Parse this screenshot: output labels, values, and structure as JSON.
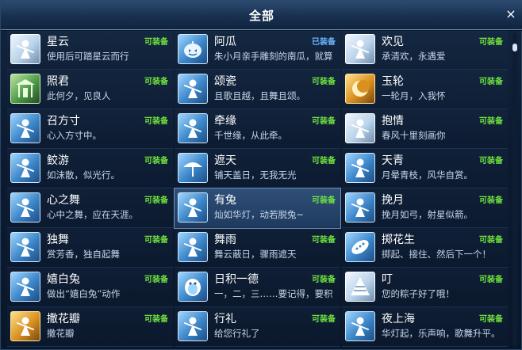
{
  "header": {
    "title": "全部",
    "close_icon": "×"
  },
  "items": [
    {
      "name": "星云",
      "desc": "使用后可踏星云而行",
      "status": "可装备",
      "icon": "figure-icon",
      "state": "available"
    },
    {
      "name": "阿瓜",
      "desc": "朱小月亲手雕刻的南瓜，就算",
      "status": "已装备",
      "icon": "pumpkin-icon",
      "state": "equipped"
    },
    {
      "name": "欢见",
      "desc": "承清欢，永遇爱",
      "status": "可装备",
      "icon": "couple-icon",
      "state": "available"
    },
    {
      "name": "照君",
      "desc": "此何夕，见良人",
      "status": "可装备",
      "icon": "pavilion-icon",
      "state": "available"
    },
    {
      "name": "颂瓷",
      "desc": "且歌且越，且舞且颂。",
      "status": "可装备",
      "icon": "dancer-icon",
      "state": "available"
    },
    {
      "name": "玉轮",
      "desc": "一轮月，入我怀",
      "status": "可装备",
      "icon": "moon-icon",
      "state": "available"
    },
    {
      "name": "召方寸",
      "desc": "心入方寸中。",
      "status": "可装备",
      "icon": "box-icon",
      "state": "available"
    },
    {
      "name": "牵缘",
      "desc": "千世缘，从此牵。",
      "status": "可装备",
      "icon": "wave-icon",
      "state": "available"
    },
    {
      "name": "抱情",
      "desc": "春风十里刻画你",
      "status": "可装备",
      "icon": "hug-icon",
      "state": "available"
    },
    {
      "name": "鲛游",
      "desc": "如沫散，似光行。",
      "status": "可装备",
      "icon": "fish-icon",
      "state": "available"
    },
    {
      "name": "遮天",
      "desc": "铺天盖日，无我无光",
      "status": "可装备",
      "icon": "umbrella-icon",
      "state": "available"
    },
    {
      "name": "天青",
      "desc": "月晕青枝，风华自赏。",
      "status": "可装备",
      "icon": "branch-icon",
      "state": "available"
    },
    {
      "name": "心之舞",
      "desc": "心中之舞，应在天涯。",
      "status": "可装备",
      "icon": "dance-icon",
      "state": "available"
    },
    {
      "name": "有兔",
      "desc": "灿如华灯，动若脱兔~",
      "status": "可装备",
      "icon": "rabbit-icon",
      "state": "available"
    },
    {
      "name": "挽月",
      "desc": "挽月如弓，射星似箭。",
      "status": "可装备",
      "icon": "archer-icon",
      "state": "available"
    },
    {
      "name": "独舞",
      "desc": "赏芳香，独自起舞",
      "status": "可装备",
      "icon": "solo-dance-icon",
      "state": "available"
    },
    {
      "name": "舞雨",
      "desc": "舞云蔽日，骤雨遮天",
      "status": "可装备",
      "icon": "rain-icon",
      "state": "available"
    },
    {
      "name": "掷花生",
      "desc": "掷起、接住、然后下一个！",
      "status": "可装备",
      "icon": "peanut-icon",
      "state": "available"
    },
    {
      "name": "嬉白兔",
      "desc": "做出“嬉白兔”动作",
      "status": "可装备",
      "icon": "white-rabbit-icon",
      "state": "available"
    },
    {
      "name": "日积一德",
      "desc": "一，二，三……要记得，要积",
      "status": "可装备",
      "icon": "penguin-icon",
      "state": "available"
    },
    {
      "name": "叮",
      "desc": "您的粽子好了哦！",
      "status": "可装备",
      "icon": "zongzi-icon",
      "state": "available"
    },
    {
      "name": "撒花瓣",
      "desc": "撒花瓣",
      "status": "可装备",
      "icon": "petal-icon",
      "state": "available"
    },
    {
      "name": "行礼",
      "desc": "给您行礼了",
      "status": "可装备",
      "icon": "bow-icon",
      "state": "available"
    },
    {
      "name": "夜上海",
      "desc": "华灯起，乐声响，歌舞升平。",
      "status": "可装备",
      "icon": "shanghai-icon",
      "state": "available"
    }
  ],
  "selected_index": 13,
  "colors": {
    "available": "#6fe33e",
    "equipped": "#6ab4ff"
  }
}
